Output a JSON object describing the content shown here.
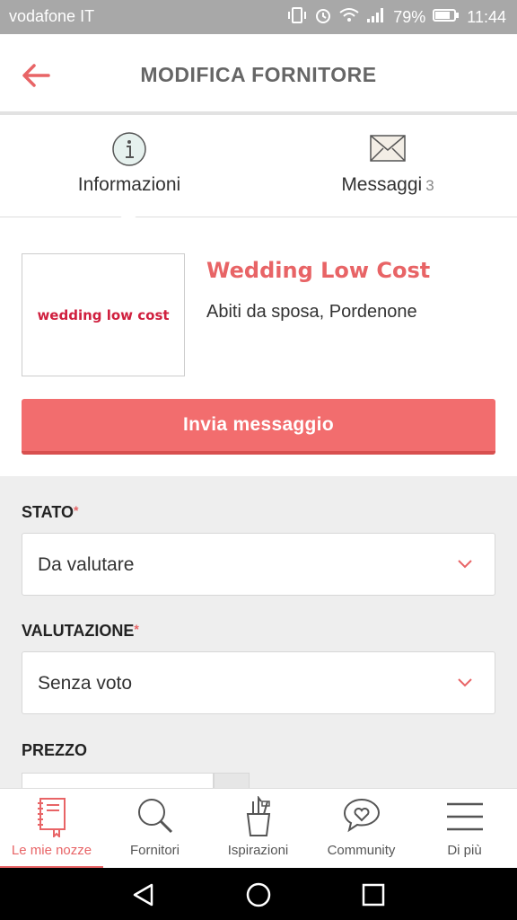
{
  "status_bar": {
    "carrier": "vodafone IT",
    "battery": "79%",
    "time": "11:44"
  },
  "app_bar": {
    "title": "MODIFICA FORNITORE"
  },
  "tabs": [
    {
      "label": "Informazioni",
      "icon": "info-icon"
    },
    {
      "label": "Messaggi",
      "count": "3",
      "icon": "envelope-icon"
    }
  ],
  "vendor": {
    "logo_text": "wedding low cost",
    "name": "Wedding Low Cost",
    "subtitle": "Abiti da sposa, Pordenone",
    "cta_label": "Invia messaggio"
  },
  "form": {
    "stato": {
      "label": "STATO",
      "required": "*",
      "value": "Da valutare"
    },
    "valutazione": {
      "label": "VALUTAZIONE",
      "required": "*",
      "value": "Senza voto"
    },
    "prezzo": {
      "label": "PREZZO"
    }
  },
  "bottom_nav": [
    {
      "label": "Le mie nozze",
      "icon": "notebook-icon",
      "active": true
    },
    {
      "label": "Fornitori",
      "icon": "search-icon"
    },
    {
      "label": "Ispirazioni",
      "icon": "pencil-cup-icon"
    },
    {
      "label": "Community",
      "icon": "chat-heart-icon"
    },
    {
      "label": "Di più",
      "icon": "menu-icon"
    }
  ],
  "colors": {
    "accent": "#e86466",
    "button": "#f26d6e",
    "logo": "#d0203f"
  }
}
